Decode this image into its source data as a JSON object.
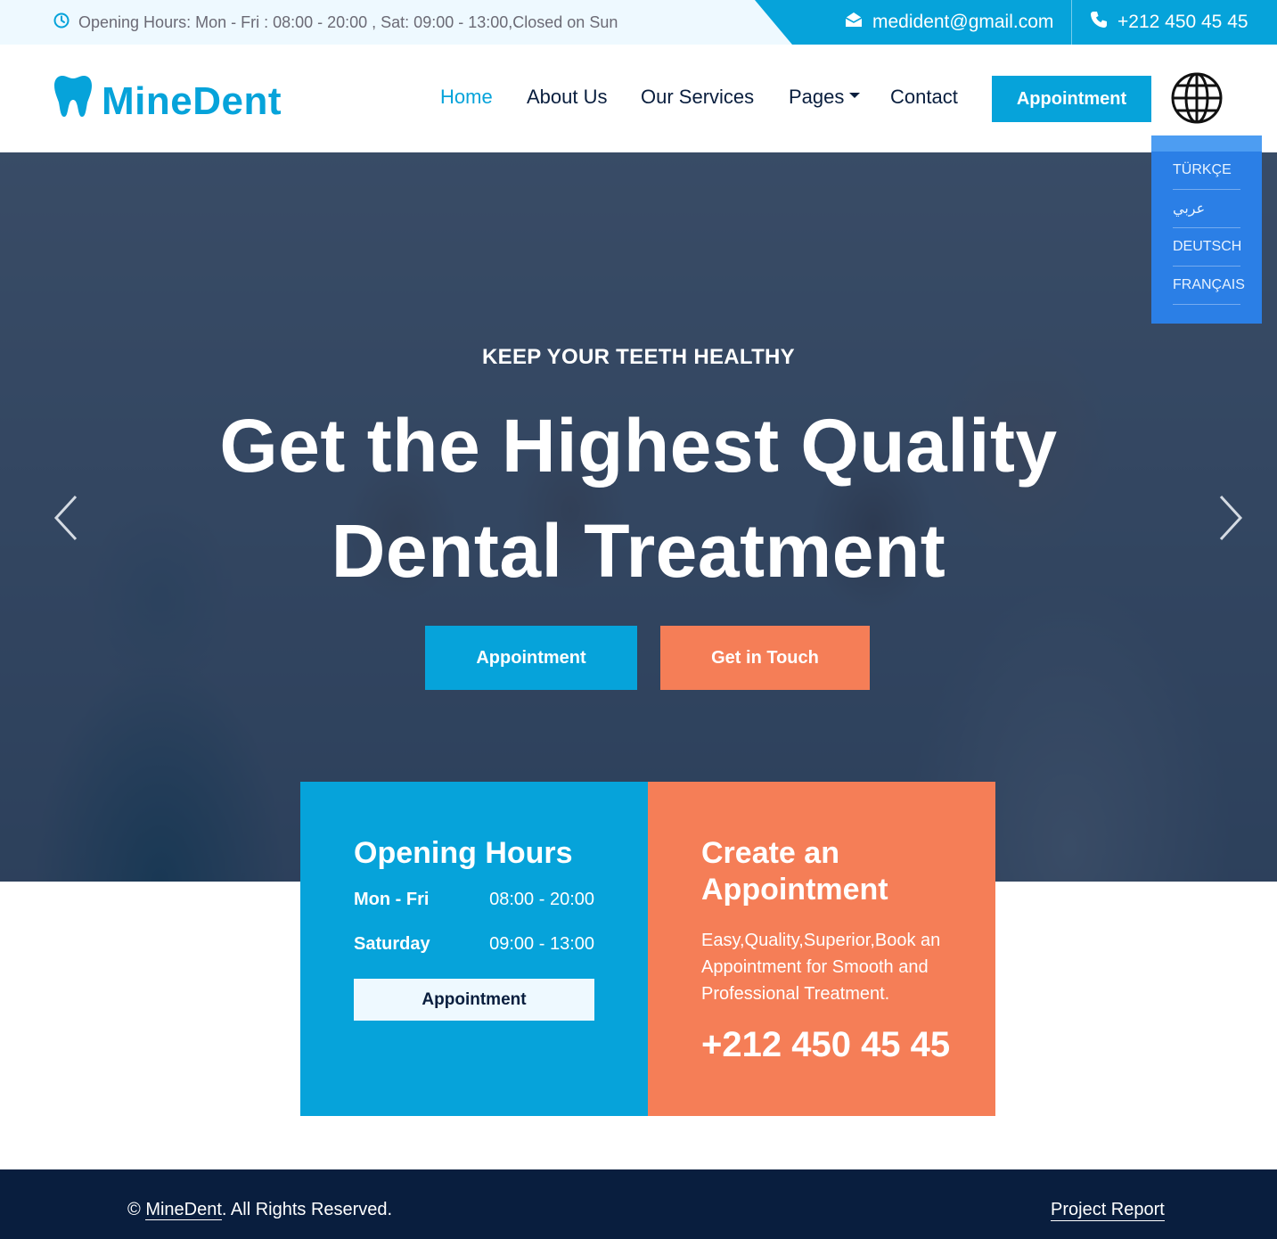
{
  "topbar": {
    "hours_text": "Opening Hours: Mon - Fri : 08:00 - 20:00 , Sat: 09:00 - 13:00,Closed on Sun",
    "email": "medident@gmail.com",
    "phone": "+212 450 45 45"
  },
  "brand": {
    "name": "MineDent",
    "color": "#06a3da"
  },
  "nav": {
    "items": [
      {
        "label": "Home",
        "active": true
      },
      {
        "label": "About Us"
      },
      {
        "label": "Our Services"
      },
      {
        "label": "Pages"
      },
      {
        "label": "Contact"
      }
    ],
    "cta": "Appointment"
  },
  "language_menu": {
    "options": [
      "TÜRKÇE",
      "عربي",
      "DEUTSCH",
      "FRANÇAIS"
    ]
  },
  "hero": {
    "subtitle": "KEEP YOUR TEETH HEALTHY",
    "title_line1": "Get the Highest Quality",
    "title_line2": "Dental Treatment",
    "primary_button": "Appointment",
    "secondary_button": "Get in Touch"
  },
  "opening_hours": {
    "title": "Opening Hours",
    "rows": [
      {
        "day": "Mon - Fri",
        "time": "08:00 - 20:00"
      },
      {
        "day": "Saturday",
        "time": "09:00 - 13:00"
      }
    ],
    "button": "Appointment"
  },
  "create_appointment": {
    "title_line1": "Create an",
    "title_line2": "Appointment",
    "text": "Easy,Quality,Superior,Book an Appointment for Smooth and Professional Treatment.",
    "phone": "+212 450 45 45"
  },
  "footer": {
    "copyright_symbol": "©",
    "brand": "MineDent",
    "rights": ". All Rights Reserved.",
    "link": "Project Report"
  },
  "colors": {
    "primary": "#06a3da",
    "secondary": "#f57e57",
    "dark": "#091e3e",
    "light": "#eef9ff",
    "dropdown": "#2b7fe6"
  }
}
